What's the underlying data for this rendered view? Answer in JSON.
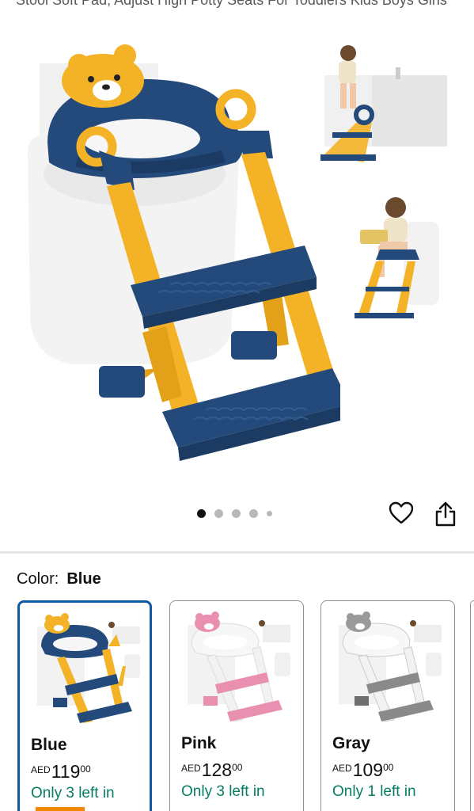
{
  "product": {
    "title_partial": "Stool Soft Pad, Adjust High Potty Seats For Toddlers Kids Boys Girls"
  },
  "gallery": {
    "image_count": 5,
    "active_index": 0
  },
  "actions": {
    "wishlist_icon": "heart-icon",
    "share_icon": "share-icon"
  },
  "color_selector": {
    "label": "Color:",
    "selected": "Blue",
    "options": [
      {
        "name": "Blue",
        "currency": "AED",
        "whole": "119",
        "fraction": "00",
        "stock": "Only 3 left in",
        "accent": "#234a7a"
      },
      {
        "name": "Pink",
        "currency": "AED",
        "whole": "128",
        "fraction": "00",
        "stock": "Only 3 left in",
        "accent": "#e98fb0"
      },
      {
        "name": "Gray",
        "currency": "AED",
        "whole": "109",
        "fraction": "00",
        "stock": "Only 1 left in",
        "accent": "#8a8a8a"
      }
    ]
  },
  "colors": {
    "selected_border": "#0f5aa5",
    "in_stock_text": "#067d62",
    "step_blue": "#234a7a",
    "frame_yellow": "#f4b227"
  }
}
